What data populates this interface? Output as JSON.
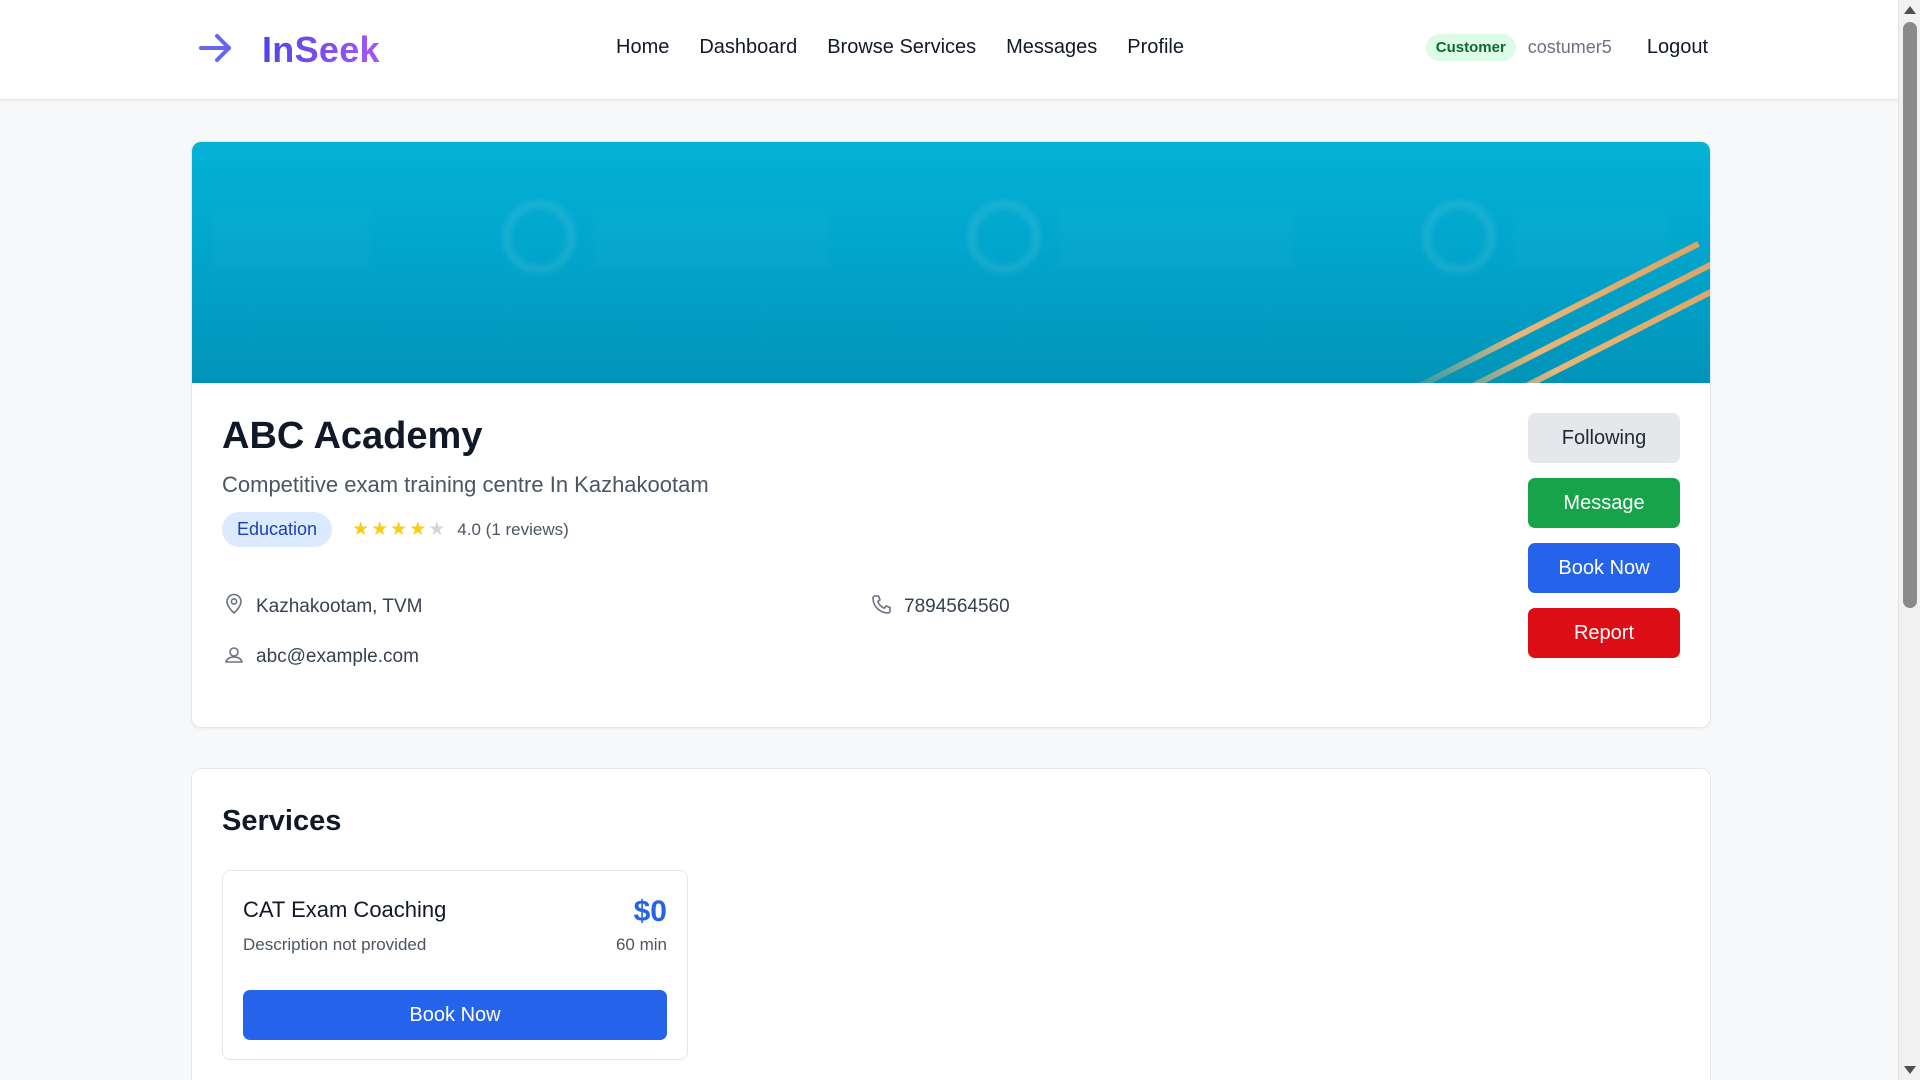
{
  "brand": {
    "name": "InSeek",
    "icon": "arrow-right-icon",
    "gradient": [
      "#4f46e5",
      "#a855f7"
    ]
  },
  "nav": {
    "links": [
      {
        "label": "Home"
      },
      {
        "label": "Dashboard"
      },
      {
        "label": "Browse Services"
      },
      {
        "label": "Messages"
      },
      {
        "label": "Profile"
      }
    ],
    "role": "Customer",
    "username": "costumer5",
    "logout": "Logout"
  },
  "provider": {
    "name": "ABC Academy",
    "tagline": "Competitive exam training centre In Kazhakootam",
    "category": "Education",
    "rating": 4.0,
    "rating_text": "4.0 (1 reviews)",
    "location": "Kazhakootam, TVM",
    "phone": "7894564560",
    "email": "abc@example.com",
    "banner_color": "#04b2d6"
  },
  "actions": {
    "following": "Following",
    "message": "Message",
    "book": "Book Now",
    "report": "Report"
  },
  "services": {
    "title": "Services",
    "items": [
      {
        "name": "CAT Exam Coaching",
        "description": "Description not provided",
        "price": "$0",
        "duration": "60 min",
        "book": "Book Now"
      }
    ]
  },
  "colors": {
    "primary": "#2563eb",
    "success": "#16a34a",
    "danger": "#dc0d14",
    "star": "#facc15"
  }
}
